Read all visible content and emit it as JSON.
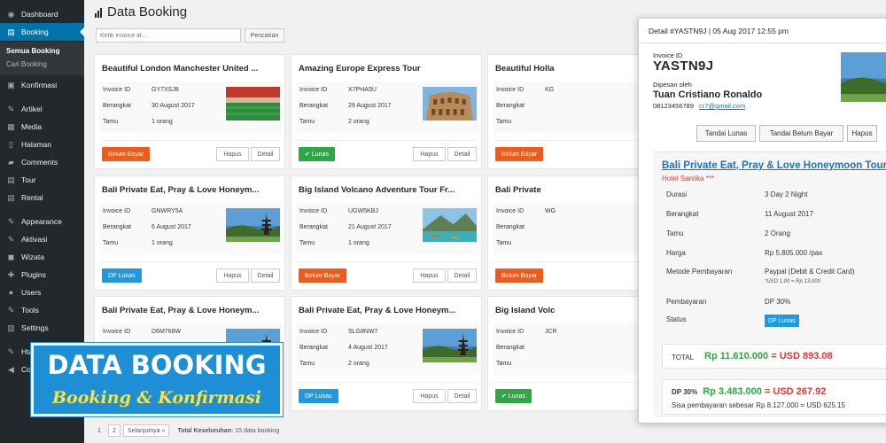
{
  "sidebar": {
    "items": [
      {
        "icon": "dashboard-icon",
        "glyph": "◉",
        "label": "Dashboard"
      },
      {
        "icon": "booking-icon",
        "glyph": "▤",
        "label": "Booking",
        "active": true
      },
      {
        "icon": "konfirmasi-icon",
        "glyph": "▣",
        "label": "Konfirmasi"
      },
      {
        "icon": "artikel-icon",
        "glyph": "✎",
        "label": "Artikel"
      },
      {
        "icon": "media-icon",
        "glyph": "▦",
        "label": "Media"
      },
      {
        "icon": "halaman-icon",
        "glyph": "▯",
        "label": "Halaman"
      },
      {
        "icon": "comments-icon",
        "glyph": "▰",
        "label": "Comments"
      },
      {
        "icon": "tour-icon",
        "glyph": "▤",
        "label": "Tour"
      },
      {
        "icon": "rental-icon",
        "glyph": "▤",
        "label": "Rental"
      },
      {
        "icon": "appearance-icon",
        "glyph": "✎",
        "label": "Appearance"
      },
      {
        "icon": "aktivasi-icon",
        "glyph": "✎",
        "label": "Aktivasi"
      },
      {
        "icon": "wizata-icon",
        "glyph": "◼",
        "label": "Wizata"
      },
      {
        "icon": "plugins-icon",
        "glyph": "✚",
        "label": "Plugins"
      },
      {
        "icon": "users-icon",
        "glyph": "●",
        "label": "Users"
      },
      {
        "icon": "tools-icon",
        "glyph": "✎",
        "label": "Tools"
      },
      {
        "icon": "settings-icon",
        "glyph": "▥",
        "label": "Settings"
      },
      {
        "icon": "htaccess-icon",
        "glyph": "✎",
        "label": "Hta"
      },
      {
        "icon": "collapse-icon",
        "glyph": "◀",
        "label": "Coll"
      }
    ],
    "submenu": [
      "Semua Booking",
      "Cari Booking"
    ]
  },
  "header": {
    "title": "Data Booking"
  },
  "search": {
    "placeholder": "Ketik invoice id...",
    "button": "Pencarian"
  },
  "card_labels": {
    "invoice": "Invoice ID",
    "date": "Berangkat",
    "guests": "Tamu",
    "delete": "Hapus",
    "detail": "Detail"
  },
  "cards": [
    {
      "title": "Beautiful London Manchester United ...",
      "invoice": "GY7XSJ8",
      "date": "30 August 2017",
      "guests": "1 orang",
      "status": "Belum Bayar",
      "status_type": "belum",
      "image": "stadium"
    },
    {
      "title": "Amazing Europe Express Tour",
      "invoice": "X7PHA5U",
      "date": "29 August 2017",
      "guests": "2 orang",
      "status": "Lunas",
      "status_type": "lunas",
      "image": "colosseum"
    },
    {
      "title": "Beautiful Holla",
      "invoice": "KG",
      "date": "",
      "guests": "",
      "status": "Belum Bayar",
      "status_type": "belum",
      "image": "none"
    },
    {
      "title": "Bali Private Eat, Pray & Love Honeym...",
      "invoice": "GNWRY5A",
      "date": "6 August 2017",
      "guests": "1 orang",
      "status": "DP Lunas",
      "status_type": "dp",
      "image": "bali"
    },
    {
      "title": "Big Island Volcano Adventure Tour Fr...",
      "invoice": "UGW5KBJ",
      "date": "21 August 2017",
      "guests": "1 orang",
      "status": "Belum Bayar",
      "status_type": "belum",
      "image": "volcano"
    },
    {
      "title": "Bali Private",
      "invoice": "WG",
      "date": "",
      "guests": "",
      "status": "Belum Bayar",
      "status_type": "belum",
      "image": "none"
    },
    {
      "title": "Bali Private Eat, Pray & Love Honeym...",
      "invoice": "D5M768W",
      "date": "",
      "guests": "",
      "status": "",
      "status_type": "none",
      "image": "bali"
    },
    {
      "title": "Bali Private Eat, Pray & Love Honeym...",
      "invoice": "SLG8NW7",
      "date": "4 August 2017",
      "guests": "2 orang",
      "status": "DP Lunas",
      "status_type": "dp",
      "image": "bali"
    },
    {
      "title": "Big Island Volc",
      "invoice": "JCR",
      "date": "",
      "guests": "",
      "status": "Lunas",
      "status_type": "lunas",
      "image": "none"
    }
  ],
  "pagination": {
    "pages": [
      "1",
      "2"
    ],
    "next": "Selanjutnya »",
    "total_label": "Total Keseluruhan:",
    "total_value": "15 data booking"
  },
  "overlay": {
    "title": "DATA BOOKING",
    "subtitle": "Booking & Konfirmasi"
  },
  "detail": {
    "header": "Detail #YASTN9J | 05 Aug 2017 12:55 pm",
    "invoice_label": "Invoice ID",
    "invoice_code": "YASTN9J",
    "booked_by_label": "Dipesan oleh",
    "booked_by": "Tuan Cristiano Ronaldo",
    "phone": "08123456789",
    "email": "cr7@gmail.com",
    "buttons": {
      "paid": "Tandai Lunas",
      "unpaid": "Tandai Belum Bayar",
      "delete": "Hapus"
    },
    "tour_title": "Bali Private Eat, Pray & Love Honeymoon Tour",
    "hotel": "Hotel Santika ***",
    "rows": [
      {
        "label": "Durasi",
        "value": "3 Day 2 Night"
      },
      {
        "label": "Berangkat",
        "value": "11 August 2017"
      },
      {
        "label": "Tamu",
        "value": "2 Orang"
      },
      {
        "label": "Harga",
        "value": "Rp 5.805.000 /pax"
      },
      {
        "label": "Metode Pembayaran",
        "value": "Paypal (Debit & Credit Card)",
        "note": "*USD 1.00 = Rp 13.000"
      },
      {
        "label": "Pembayaran",
        "value": "DP 30%"
      },
      {
        "label": "Status",
        "value": "DP Lunas"
      }
    ],
    "total_label": "TOTAL",
    "total_idr": "Rp 11.610.000",
    "total_usd": "= USD 893.08",
    "dp_label": "DP 30%",
    "dp_idr": "Rp 3.483.000",
    "dp_usd": "= USD 267.92",
    "rest": "Sisa pembayaran sebesar Rp 8.127.000 = USD 625.15"
  }
}
